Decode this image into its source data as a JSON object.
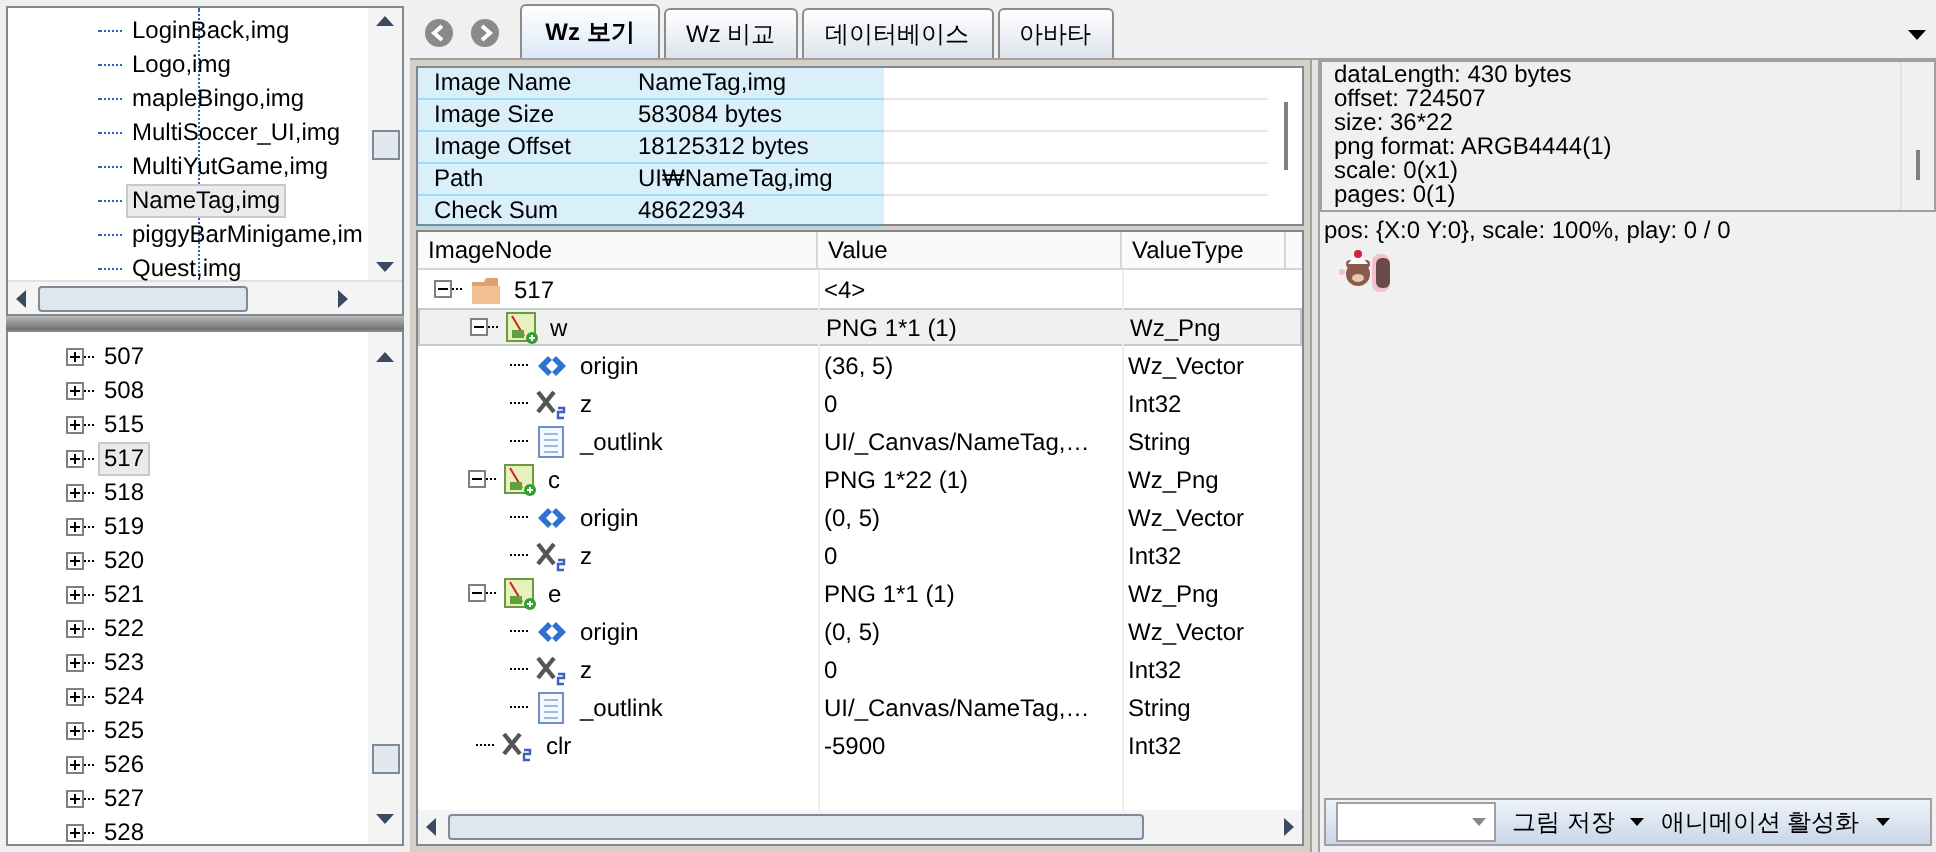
{
  "file_list": {
    "items": [
      {
        "label": "LoginBack,img",
        "selected": false
      },
      {
        "label": "Logo,img",
        "selected": false
      },
      {
        "label": "mapleBingo,img",
        "selected": false
      },
      {
        "label": "MultiSoccer_UI,img",
        "selected": false
      },
      {
        "label": "MultiYutGame,img",
        "selected": false
      },
      {
        "label": "NameTag,img",
        "selected": true
      },
      {
        "label": "piggyBarMinigame,im",
        "selected": false
      },
      {
        "label": "Quest,img",
        "selected": false
      }
    ]
  },
  "node_list": {
    "items": [
      {
        "label": "507",
        "selected": false,
        "expanded": false
      },
      {
        "label": "508",
        "selected": false,
        "expanded": false
      },
      {
        "label": "515",
        "selected": false,
        "expanded": false
      },
      {
        "label": "517",
        "selected": true,
        "expanded": false
      },
      {
        "label": "518",
        "selected": false,
        "expanded": false
      },
      {
        "label": "519",
        "selected": false,
        "expanded": false
      },
      {
        "label": "520",
        "selected": false,
        "expanded": false
      },
      {
        "label": "521",
        "selected": false,
        "expanded": false
      },
      {
        "label": "522",
        "selected": false,
        "expanded": false
      },
      {
        "label": "523",
        "selected": false,
        "expanded": false
      },
      {
        "label": "524",
        "selected": false,
        "expanded": false
      },
      {
        "label": "525",
        "selected": false,
        "expanded": false
      },
      {
        "label": "526",
        "selected": false,
        "expanded": false
      },
      {
        "label": "527",
        "selected": false,
        "expanded": false
      },
      {
        "label": "528",
        "selected": false,
        "expanded": false
      }
    ]
  },
  "tabs": [
    {
      "label": "Wz 보기",
      "selected": true
    },
    {
      "label": "Wz 비교",
      "selected": false
    },
    {
      "label": "데이터베이스",
      "selected": false
    },
    {
      "label": "아바타",
      "selected": false
    }
  ],
  "image_info": [
    {
      "label": "Image Name",
      "value": "NameTag,img"
    },
    {
      "label": "Image Size",
      "value": "583084 bytes"
    },
    {
      "label": "Image Offset",
      "value": "18125312 bytes"
    },
    {
      "label": "Path",
      "value": "UI₩NameTag,img"
    },
    {
      "label": "Check Sum",
      "value": "48622934"
    }
  ],
  "node_grid": {
    "columns": [
      "ImageNode",
      "Value",
      "ValueType"
    ],
    "rows": [
      {
        "kind": "folder",
        "name": "517",
        "value": "<4>",
        "type": "",
        "expanded": true,
        "selected": false,
        "children": [
          {
            "kind": "png",
            "name": "w",
            "value": "PNG 1*1 (1)",
            "type": "Wz_Png",
            "expanded": true,
            "selected": true,
            "children": [
              {
                "kind": "vector",
                "name": "origin",
                "value": "(36, 5)",
                "type": "Wz_Vector",
                "selected": false
              },
              {
                "kind": "int",
                "name": "z",
                "value": "0",
                "type": "Int32",
                "selected": false
              },
              {
                "kind": "string",
                "name": "_outlink",
                "value": "UI/_Canvas/NameTag,…",
                "type": "String",
                "selected": false
              }
            ]
          },
          {
            "kind": "png",
            "name": "c",
            "value": "PNG 1*22 (1)",
            "type": "Wz_Png",
            "expanded": true,
            "selected": false,
            "children": [
              {
                "kind": "vector",
                "name": "origin",
                "value": "(0, 5)",
                "type": "Wz_Vector",
                "selected": false
              },
              {
                "kind": "int",
                "name": "z",
                "value": "0",
                "type": "Int32",
                "selected": false
              }
            ]
          },
          {
            "kind": "png",
            "name": "e",
            "value": "PNG 1*1 (1)",
            "type": "Wz_Png",
            "expanded": true,
            "selected": false,
            "children": [
              {
                "kind": "vector",
                "name": "origin",
                "value": "(0, 5)",
                "type": "Wz_Vector",
                "selected": false
              },
              {
                "kind": "int",
                "name": "z",
                "value": "0",
                "type": "Int32",
                "selected": false
              },
              {
                "kind": "string",
                "name": "_outlink",
                "value": "UI/_Canvas/NameTag,…",
                "type": "String",
                "selected": false
              }
            ]
          },
          {
            "kind": "int",
            "name": "clr",
            "value": "-5900",
            "type": "Int32",
            "selected": false
          }
        ]
      }
    ]
  },
  "details": {
    "lines": [
      "dataLength: 430 bytes",
      "offset: 724507",
      "size: 36*22",
      "png format: ARGB4444(1)",
      "scale: 0(x1)",
      "pages: 0(1)"
    ]
  },
  "preview": {
    "status": "pos: {X:0 Y:0}, scale: 100%, play: 0 / 0",
    "kind": "picture"
  },
  "toolbar": {
    "save_label": "그림 저장",
    "animation_label": "애니메이션 활성화"
  }
}
